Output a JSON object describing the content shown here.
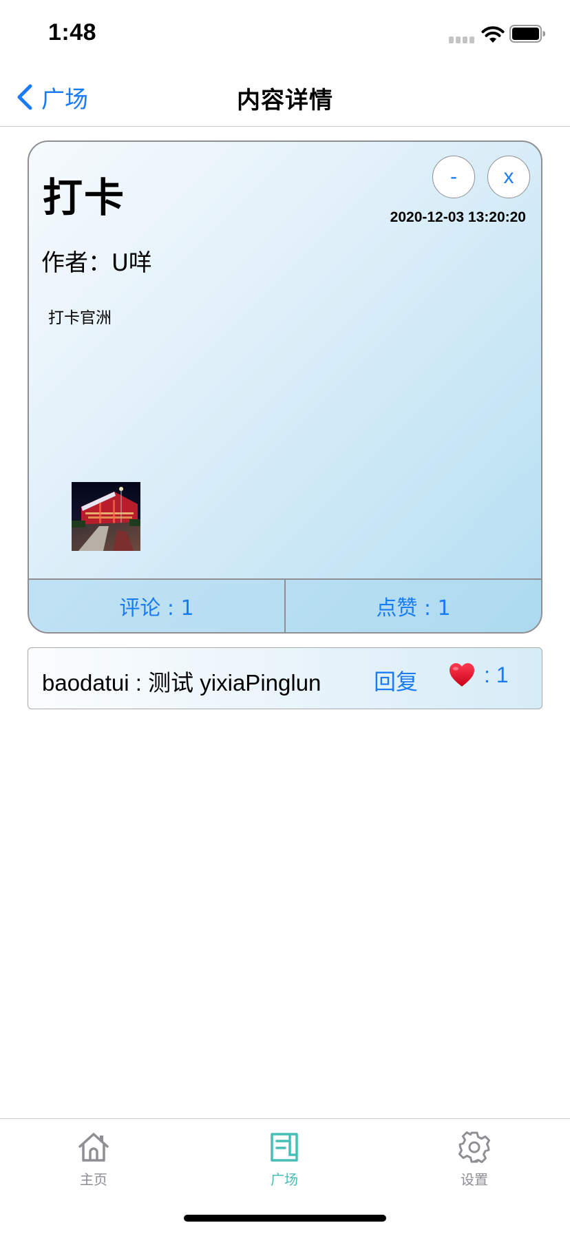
{
  "status_bar": {
    "time": "1:48"
  },
  "nav": {
    "back_label": "广场",
    "title": "内容详情"
  },
  "post": {
    "title": "打卡",
    "minus_label": "-",
    "close_label": "x",
    "timestamp": "2020-12-03 13:20:20",
    "author": "作者：U咩",
    "body": "打卡官洲",
    "comments_label": "评论 : 1",
    "likes_label": "点赞 : 1"
  },
  "comment": {
    "text": "baodatui : 测试 yixiaPinglun",
    "reply_label": "回复",
    "like_count": ": 1"
  },
  "tabs": [
    {
      "label": "主页",
      "icon": "home-icon"
    },
    {
      "label": "广场",
      "icon": "square-icon",
      "active": true
    },
    {
      "label": "设置",
      "icon": "gear-icon"
    }
  ],
  "colors": {
    "accent": "#1a7cf5",
    "active_tab": "#45bfb5",
    "inactive_tab": "#8e8e93",
    "like_heart": "#e3102b"
  }
}
